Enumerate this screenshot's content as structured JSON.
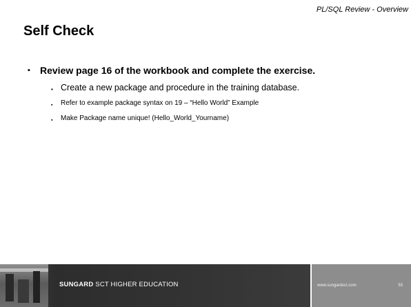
{
  "header": {
    "section": "PL/SQL  Review - Overview"
  },
  "slide": {
    "title": "Self Check",
    "main_bullet": "Review page 16 of the workbook and complete the exercise.",
    "sub_bullets": [
      "Create a new package and procedure in the training database.",
      "Refer to example package syntax on 19 – “Hello World” Example",
      "Make Package name unique! (Hello_World_Yourname)"
    ],
    "bullet_marker": "▪"
  },
  "footer": {
    "brand": "SUNGARD",
    "tagline": "SCT HIGHER EDUCATION",
    "url": "www.sungardsct.com",
    "page_number": "53"
  }
}
